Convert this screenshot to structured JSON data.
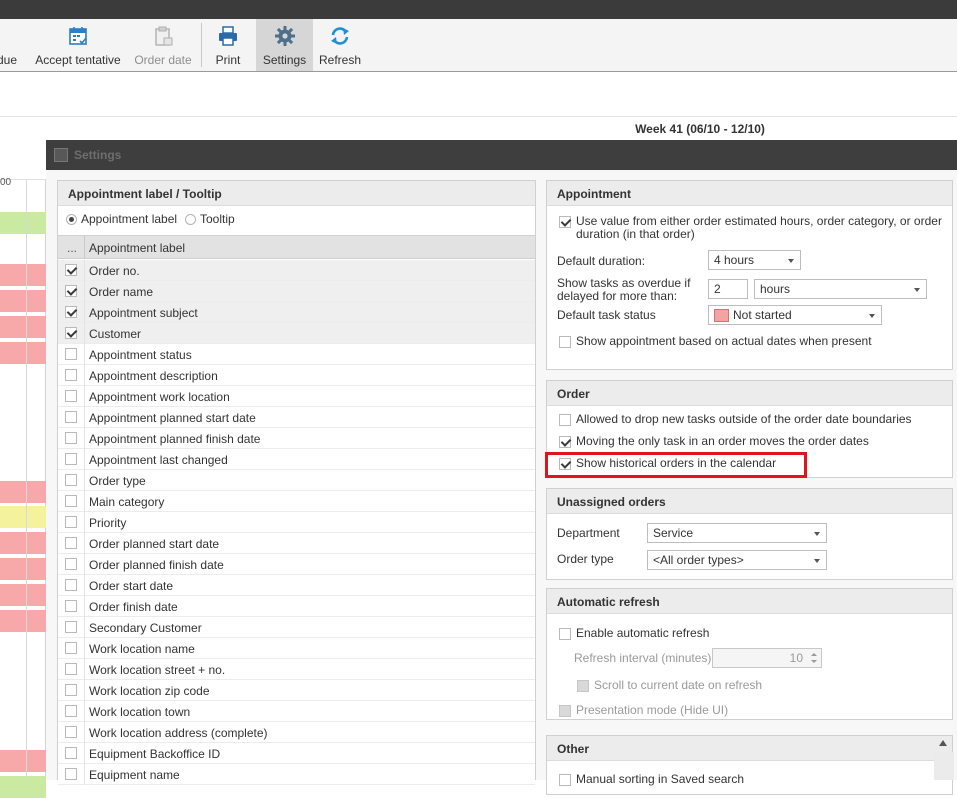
{
  "ribbon": {
    "items": [
      {
        "label": "due",
        "icon": "overdue-icon",
        "state": "normal"
      },
      {
        "label": "Accept tentative",
        "icon": "calendar-accept-icon",
        "state": "normal"
      },
      {
        "label": "Order date",
        "icon": "clipboard-date-icon",
        "state": "disabled"
      },
      {
        "label": "Print",
        "icon": "printer-icon",
        "state": "normal"
      },
      {
        "label": "Settings",
        "icon": "gear-icon",
        "state": "active"
      },
      {
        "label": "Refresh",
        "icon": "refresh-icon",
        "state": "normal"
      }
    ]
  },
  "calendar": {
    "week_label": "Week 41 (06/10 - 12/10)",
    "time_header": "00",
    "row_colors": [
      "#c9eaa0",
      "#f7a9a9",
      "#f7a9a9",
      "#f7a9a9",
      "#f7a9a9",
      "#f7a9a9",
      "#f5f29e",
      "#f7a9a9",
      "#f7a9a9",
      "#f7a9a9",
      "#f7a9a9",
      "#f7a9a9",
      "#c9eaa0"
    ]
  },
  "settings": {
    "title": "Settings",
    "appointment_label": {
      "header": "Appointment label / Tooltip",
      "radio_appointment": "Appointment label",
      "radio_tooltip": "Tooltip",
      "grid_header_dots": "...",
      "grid_header_label": "Appointment label",
      "rows": [
        {
          "label": "Order no.",
          "checked": true
        },
        {
          "label": "Order name",
          "checked": true
        },
        {
          "label": "Appointment subject",
          "checked": true
        },
        {
          "label": "Customer",
          "checked": true
        },
        {
          "label": "Appointment status",
          "checked": false
        },
        {
          "label": "Appointment description",
          "checked": false
        },
        {
          "label": "Appointment work location",
          "checked": false
        },
        {
          "label": "Appointment planned start date",
          "checked": false
        },
        {
          "label": "Appointment planned finish date",
          "checked": false
        },
        {
          "label": "Appointment last changed",
          "checked": false
        },
        {
          "label": "Order type",
          "checked": false
        },
        {
          "label": "Main category",
          "checked": false
        },
        {
          "label": "Priority",
          "checked": false
        },
        {
          "label": "Order planned start date",
          "checked": false
        },
        {
          "label": "Order planned finish date",
          "checked": false
        },
        {
          "label": "Order start date",
          "checked": false
        },
        {
          "label": "Order finish date",
          "checked": false
        },
        {
          "label": "Secondary Customer",
          "checked": false
        },
        {
          "label": "Work location name",
          "checked": false
        },
        {
          "label": "Work location street + no.",
          "checked": false
        },
        {
          "label": "Work location zip code",
          "checked": false
        },
        {
          "label": "Work location town",
          "checked": false
        },
        {
          "label": "Work location address (complete)",
          "checked": false
        },
        {
          "label": "Equipment Backoffice ID",
          "checked": false
        },
        {
          "label": "Equipment name",
          "checked": false
        }
      ]
    },
    "appointment": {
      "header": "Appointment",
      "use_value_line1": "Use value from either order estimated hours, order category, or order",
      "use_value_line2": "duration (in that order)",
      "default_duration_label": "Default duration:",
      "default_duration_value": "4 hours",
      "overdue_label_line1": "Show tasks as overdue if",
      "overdue_label_line2": "delayed for more than:",
      "overdue_value": "2",
      "overdue_unit": "hours",
      "task_status_label": "Default task status",
      "task_status_value": "Not started",
      "task_status_color": "#f4a3a3",
      "actual_dates": "Show appointment based on actual dates when present"
    },
    "order": {
      "header": "Order",
      "allow_drop": "Allowed to drop new tasks outside of the order date boundaries",
      "moving_only": "Moving the only task in an order moves the order dates",
      "show_historical": "Show historical orders in the calendar"
    },
    "unassigned": {
      "header": "Unassigned orders",
      "department_label": "Department",
      "department_value": "Service",
      "order_type_label": "Order type",
      "order_type_value": "<All order types>"
    },
    "auto_refresh": {
      "header": "Automatic refresh",
      "enable": "Enable automatic refresh",
      "interval_label": "Refresh interval (minutes)",
      "interval_value": "10",
      "scroll_current": "Scroll to current date on refresh",
      "presentation": "Presentation mode (Hide UI)"
    },
    "other": {
      "header": "Other",
      "manual_sorting": "Manual sorting in Saved search"
    }
  }
}
